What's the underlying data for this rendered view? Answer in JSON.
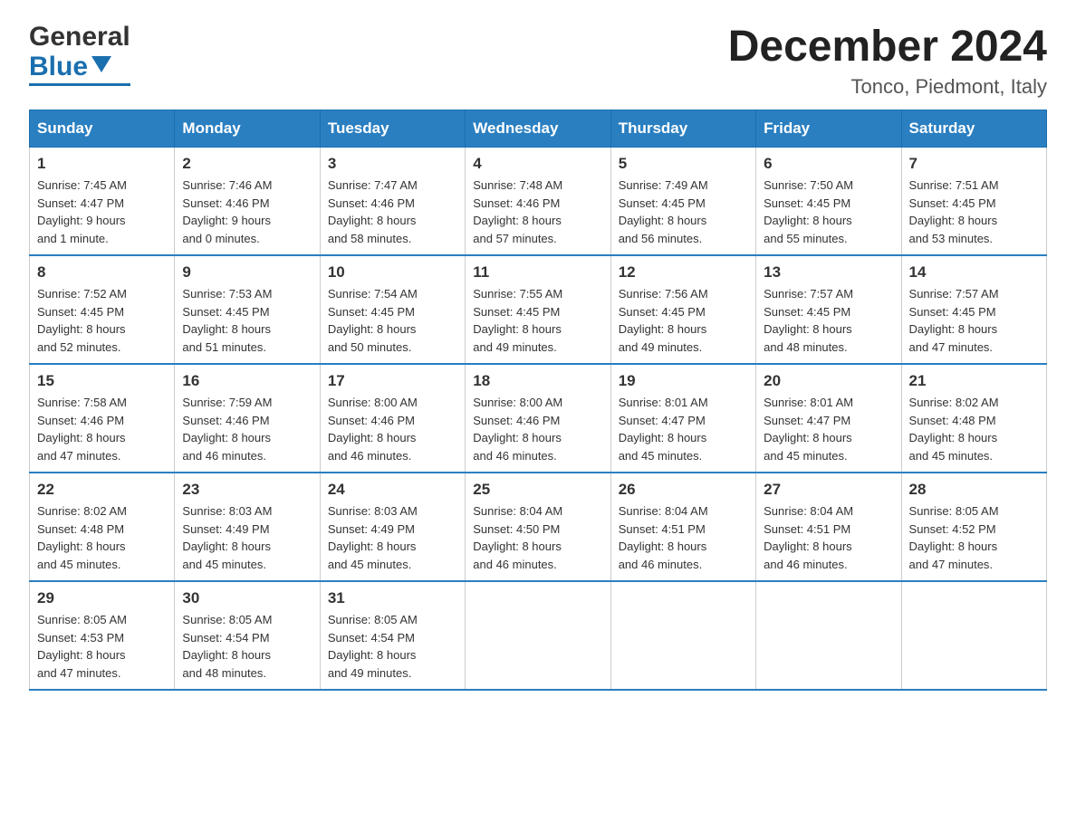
{
  "header": {
    "logo_line1": "General",
    "logo_line2": "Blue",
    "month_title": "December 2024",
    "location": "Tonco, Piedmont, Italy"
  },
  "days_of_week": [
    "Sunday",
    "Monday",
    "Tuesday",
    "Wednesday",
    "Thursday",
    "Friday",
    "Saturday"
  ],
  "weeks": [
    [
      {
        "day": "1",
        "sunrise": "7:45 AM",
        "sunset": "4:47 PM",
        "daylight": "9 hours and 1 minute."
      },
      {
        "day": "2",
        "sunrise": "7:46 AM",
        "sunset": "4:46 PM",
        "daylight": "9 hours and 0 minutes."
      },
      {
        "day": "3",
        "sunrise": "7:47 AM",
        "sunset": "4:46 PM",
        "daylight": "8 hours and 58 minutes."
      },
      {
        "day": "4",
        "sunrise": "7:48 AM",
        "sunset": "4:46 PM",
        "daylight": "8 hours and 57 minutes."
      },
      {
        "day": "5",
        "sunrise": "7:49 AM",
        "sunset": "4:45 PM",
        "daylight": "8 hours and 56 minutes."
      },
      {
        "day": "6",
        "sunrise": "7:50 AM",
        "sunset": "4:45 PM",
        "daylight": "8 hours and 55 minutes."
      },
      {
        "day": "7",
        "sunrise": "7:51 AM",
        "sunset": "4:45 PM",
        "daylight": "8 hours and 53 minutes."
      }
    ],
    [
      {
        "day": "8",
        "sunrise": "7:52 AM",
        "sunset": "4:45 PM",
        "daylight": "8 hours and 52 minutes."
      },
      {
        "day": "9",
        "sunrise": "7:53 AM",
        "sunset": "4:45 PM",
        "daylight": "8 hours and 51 minutes."
      },
      {
        "day": "10",
        "sunrise": "7:54 AM",
        "sunset": "4:45 PM",
        "daylight": "8 hours and 50 minutes."
      },
      {
        "day": "11",
        "sunrise": "7:55 AM",
        "sunset": "4:45 PM",
        "daylight": "8 hours and 49 minutes."
      },
      {
        "day": "12",
        "sunrise": "7:56 AM",
        "sunset": "4:45 PM",
        "daylight": "8 hours and 49 minutes."
      },
      {
        "day": "13",
        "sunrise": "7:57 AM",
        "sunset": "4:45 PM",
        "daylight": "8 hours and 48 minutes."
      },
      {
        "day": "14",
        "sunrise": "7:57 AM",
        "sunset": "4:45 PM",
        "daylight": "8 hours and 47 minutes."
      }
    ],
    [
      {
        "day": "15",
        "sunrise": "7:58 AM",
        "sunset": "4:46 PM",
        "daylight": "8 hours and 47 minutes."
      },
      {
        "day": "16",
        "sunrise": "7:59 AM",
        "sunset": "4:46 PM",
        "daylight": "8 hours and 46 minutes."
      },
      {
        "day": "17",
        "sunrise": "8:00 AM",
        "sunset": "4:46 PM",
        "daylight": "8 hours and 46 minutes."
      },
      {
        "day": "18",
        "sunrise": "8:00 AM",
        "sunset": "4:46 PM",
        "daylight": "8 hours and 46 minutes."
      },
      {
        "day": "19",
        "sunrise": "8:01 AM",
        "sunset": "4:47 PM",
        "daylight": "8 hours and 45 minutes."
      },
      {
        "day": "20",
        "sunrise": "8:01 AM",
        "sunset": "4:47 PM",
        "daylight": "8 hours and 45 minutes."
      },
      {
        "day": "21",
        "sunrise": "8:02 AM",
        "sunset": "4:48 PM",
        "daylight": "8 hours and 45 minutes."
      }
    ],
    [
      {
        "day": "22",
        "sunrise": "8:02 AM",
        "sunset": "4:48 PM",
        "daylight": "8 hours and 45 minutes."
      },
      {
        "day": "23",
        "sunrise": "8:03 AM",
        "sunset": "4:49 PM",
        "daylight": "8 hours and 45 minutes."
      },
      {
        "day": "24",
        "sunrise": "8:03 AM",
        "sunset": "4:49 PM",
        "daylight": "8 hours and 45 minutes."
      },
      {
        "day": "25",
        "sunrise": "8:04 AM",
        "sunset": "4:50 PM",
        "daylight": "8 hours and 46 minutes."
      },
      {
        "day": "26",
        "sunrise": "8:04 AM",
        "sunset": "4:51 PM",
        "daylight": "8 hours and 46 minutes."
      },
      {
        "day": "27",
        "sunrise": "8:04 AM",
        "sunset": "4:51 PM",
        "daylight": "8 hours and 46 minutes."
      },
      {
        "day": "28",
        "sunrise": "8:05 AM",
        "sunset": "4:52 PM",
        "daylight": "8 hours and 47 minutes."
      }
    ],
    [
      {
        "day": "29",
        "sunrise": "8:05 AM",
        "sunset": "4:53 PM",
        "daylight": "8 hours and 47 minutes."
      },
      {
        "day": "30",
        "sunrise": "8:05 AM",
        "sunset": "4:54 PM",
        "daylight": "8 hours and 48 minutes."
      },
      {
        "day": "31",
        "sunrise": "8:05 AM",
        "sunset": "4:54 PM",
        "daylight": "8 hours and 49 minutes."
      },
      null,
      null,
      null,
      null
    ]
  ]
}
